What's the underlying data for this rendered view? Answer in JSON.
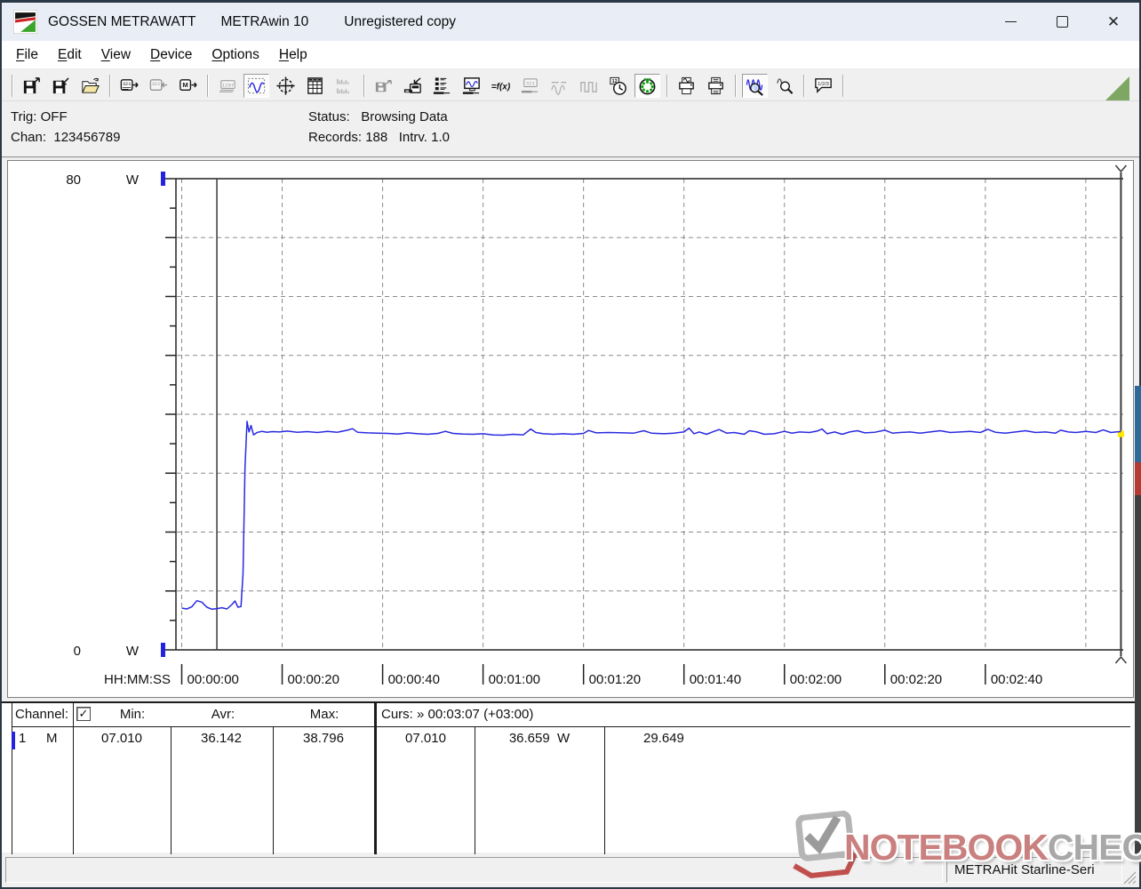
{
  "window": {
    "brand": "GOSSEN METRAWATT",
    "app": "METRAwin 10",
    "license": "Unregistered copy"
  },
  "menu": {
    "items": [
      "File",
      "Edit",
      "View",
      "Device",
      "Options",
      "Help"
    ]
  },
  "toolbar": {
    "buttons": [
      {
        "sep": true
      },
      {
        "icon": "save-chart",
        "name": "save-chart-button",
        "state": "normal"
      },
      {
        "icon": "save-data",
        "name": "save-data-button",
        "state": "normal"
      },
      {
        "icon": "open-file",
        "name": "open-file-button",
        "state": "normal"
      },
      {
        "sep": true
      },
      {
        "icon": "device-read",
        "name": "read-from-device-button",
        "state": "normal"
      },
      {
        "icon": "device-send",
        "name": "send-to-device-button",
        "state": "disabled"
      },
      {
        "icon": "memory-read",
        "name": "read-memory-button",
        "state": "normal"
      },
      {
        "sep": true
      },
      {
        "icon": "view-numeric",
        "name": "view-numeric-display-button",
        "state": "disabled"
      },
      {
        "icon": "view-line-chart",
        "name": "view-line-chart-button",
        "state": "active"
      },
      {
        "icon": "view-xy",
        "name": "view-xy-plot-button",
        "state": "normal"
      },
      {
        "icon": "view-table",
        "name": "view-data-table-button",
        "state": "normal"
      },
      {
        "icon": "view-histogram",
        "name": "view-histogram-button",
        "state": "disabled"
      },
      {
        "sep": true
      },
      {
        "icon": "export-transfer",
        "name": "export-transfer-button",
        "state": "disabled"
      },
      {
        "icon": "device-store",
        "name": "store-to-device-button",
        "state": "normal"
      },
      {
        "icon": "channel-config",
        "name": "channel-config-button",
        "state": "normal"
      },
      {
        "icon": "monitor",
        "name": "device-monitor-button",
        "state": "normal"
      },
      {
        "icon": "formula",
        "name": "formula-button",
        "state": "normal"
      },
      {
        "icon": "display-config",
        "name": "display-config-button",
        "state": "disabled"
      },
      {
        "icon": "wave-markers",
        "name": "wave-markers-button",
        "state": "disabled"
      },
      {
        "icon": "pulse-wave",
        "name": "pulse-config-button",
        "state": "disabled"
      },
      {
        "icon": "time-clock",
        "name": "time-settings-button",
        "state": "normal"
      },
      {
        "icon": "record-timer",
        "name": "record-timer-button",
        "state": "active"
      },
      {
        "sep": true
      },
      {
        "icon": "print-chart",
        "name": "print-chart-button",
        "state": "normal"
      },
      {
        "icon": "print",
        "name": "print-button",
        "state": "normal"
      },
      {
        "sep": true
      },
      {
        "icon": "zoom-wave",
        "name": "zoom-mode-button",
        "state": "active"
      },
      {
        "icon": "zoom-out-wave",
        "name": "zoom-out-button",
        "state": "normal"
      },
      {
        "sep": true
      },
      {
        "icon": "value-tooltip",
        "name": "value-tooltip-button",
        "state": "normal"
      },
      {
        "sep": true
      }
    ]
  },
  "info": {
    "trig": "Trig: OFF",
    "chan": "Chan:  123456789",
    "status": "Status:   Browsing Data",
    "records": "Records: 188   Intrv. 1.0"
  },
  "chart_data": {
    "type": "line",
    "title": "",
    "xlabel": "HH:MM:SS",
    "ylabel": "W",
    "ylim": [
      0,
      80
    ],
    "y_axis": {
      "top_label": "80",
      "bottom_label": "0",
      "unit": "W",
      "major_step": 10,
      "minor_step": 5
    },
    "grid": "dashed",
    "x_ticks": [
      {
        "t": 0,
        "label": "00:00:00"
      },
      {
        "t": 20,
        "label": "00:00:20"
      },
      {
        "t": 40,
        "label": "00:00:40"
      },
      {
        "t": 60,
        "label": "00:01:00"
      },
      {
        "t": 80,
        "label": "00:01:20"
      },
      {
        "t": 100,
        "label": "00:01:40"
      },
      {
        "t": 120,
        "label": "00:02:00"
      },
      {
        "t": 140,
        "label": "00:02:20"
      },
      {
        "t": 160,
        "label": "00:02:40"
      }
    ],
    "x_grid_seconds": [
      0,
      20,
      40,
      60,
      80,
      100,
      120,
      140,
      160,
      180
    ],
    "cursors": {
      "left_seconds": 7,
      "right_seconds": 187,
      "right_time": "00:03:07",
      "delta": "+03:00"
    },
    "stats": {
      "min": 7.01,
      "avr": 36.142,
      "max": 38.796,
      "cursor_left_value": 7.01,
      "cursor_right_value": 36.659,
      "difference": 29.649,
      "unit": "W"
    },
    "series": [
      {
        "name": "channel-1-power",
        "color": "#2a2ae0",
        "points": [
          [
            0,
            7.1
          ],
          [
            1,
            6.95
          ],
          [
            2,
            7.3
          ],
          [
            3,
            8.35
          ],
          [
            4,
            8.1
          ],
          [
            5,
            7.25
          ],
          [
            6,
            6.9
          ],
          [
            7,
            7.01
          ],
          [
            8,
            7.15
          ],
          [
            9,
            6.95
          ],
          [
            10,
            7.7
          ],
          [
            10.6,
            8.3
          ],
          [
            11.2,
            7.25
          ],
          [
            11.8,
            7.35
          ],
          [
            12.2,
            13.0
          ],
          [
            12.6,
            31.0
          ],
          [
            13,
            38.8
          ],
          [
            13.4,
            37.0
          ],
          [
            13.8,
            38.1
          ],
          [
            14.3,
            36.5
          ],
          [
            15,
            36.9
          ],
          [
            16,
            37.1
          ],
          [
            17,
            36.95
          ],
          [
            18,
            37.05
          ],
          [
            19.5,
            37.0
          ],
          [
            21,
            37.15
          ],
          [
            23,
            36.95
          ],
          [
            25,
            37.05
          ],
          [
            27,
            36.9
          ],
          [
            29,
            37.1
          ],
          [
            31,
            36.95
          ],
          [
            33,
            37.3
          ],
          [
            34,
            37.55
          ],
          [
            35,
            36.95
          ],
          [
            37,
            36.85
          ],
          [
            39,
            36.8
          ],
          [
            41,
            36.75
          ],
          [
            43,
            36.65
          ],
          [
            45,
            36.85
          ],
          [
            47,
            36.7
          ],
          [
            49,
            36.6
          ],
          [
            51,
            36.75
          ],
          [
            52.5,
            37.1
          ],
          [
            54,
            36.75
          ],
          [
            56,
            36.65
          ],
          [
            58,
            36.6
          ],
          [
            60,
            36.7
          ],
          [
            62,
            36.5
          ],
          [
            64,
            36.45
          ],
          [
            66,
            36.6
          ],
          [
            68,
            36.5
          ],
          [
            69.5,
            37.5
          ],
          [
            70.5,
            36.9
          ],
          [
            72,
            36.7
          ],
          [
            74,
            36.6
          ],
          [
            76,
            36.7
          ],
          [
            78,
            36.6
          ],
          [
            80,
            36.75
          ],
          [
            81,
            37.25
          ],
          [
            82.5,
            36.85
          ],
          [
            85,
            36.9
          ],
          [
            88,
            36.85
          ],
          [
            90,
            36.8
          ],
          [
            92,
            37.2
          ],
          [
            93.5,
            36.8
          ],
          [
            96,
            36.7
          ],
          [
            98,
            36.8
          ],
          [
            100,
            37.0
          ],
          [
            101,
            37.65
          ],
          [
            102,
            36.7
          ],
          [
            103,
            37.0
          ],
          [
            104.5,
            36.6
          ],
          [
            106,
            37.1
          ],
          [
            107,
            37.4
          ],
          [
            108.5,
            36.8
          ],
          [
            110,
            36.9
          ],
          [
            112,
            36.6
          ],
          [
            113,
            37.2
          ],
          [
            114.5,
            37.0
          ],
          [
            116,
            36.6
          ],
          [
            118,
            36.7
          ],
          [
            120,
            37.1
          ],
          [
            121.5,
            36.8
          ],
          [
            123,
            37.0
          ],
          [
            125,
            36.9
          ],
          [
            126.5,
            37.15
          ],
          [
            127.5,
            37.5
          ],
          [
            128.5,
            36.7
          ],
          [
            130,
            37.0
          ],
          [
            131.5,
            36.6
          ],
          [
            133,
            37.0
          ],
          [
            134.5,
            37.2
          ],
          [
            136,
            36.85
          ],
          [
            138,
            36.95
          ],
          [
            140,
            37.3
          ],
          [
            141.5,
            36.8
          ],
          [
            143,
            36.9
          ],
          [
            145,
            37.0
          ],
          [
            147,
            36.8
          ],
          [
            149,
            37.0
          ],
          [
            151,
            37.2
          ],
          [
            153,
            36.9
          ],
          [
            155,
            37.0
          ],
          [
            157,
            37.1
          ],
          [
            159,
            36.9
          ],
          [
            160.5,
            37.45
          ],
          [
            162,
            36.95
          ],
          [
            164,
            36.8
          ],
          [
            166,
            37.0
          ],
          [
            168,
            37.2
          ],
          [
            170,
            36.9
          ],
          [
            172,
            37.0
          ],
          [
            174,
            36.8
          ],
          [
            175,
            37.3
          ],
          [
            176.5,
            37.0
          ],
          [
            178,
            36.9
          ],
          [
            180,
            37.1
          ],
          [
            182,
            36.9
          ],
          [
            183.5,
            37.35
          ],
          [
            185,
            36.9
          ],
          [
            186,
            37.0
          ],
          [
            187,
            37.05
          ]
        ]
      }
    ]
  },
  "table": {
    "channel_header": "Channel:",
    "checkbox_checked": true,
    "min_header": "Min:",
    "avr_header": "Avr:",
    "max_header": "Max:",
    "curs_header": "Curs: » 00:03:07 (+03:00)",
    "row": {
      "num": "1",
      "mode": "M",
      "min": "07.010",
      "avr": "36.142",
      "max": "38.796",
      "curs_left": "07.010",
      "curs_right": "36.659  W",
      "diff": "29.649"
    }
  },
  "statusbar": {
    "device": "METRAHit Starline-Seri"
  },
  "watermark": {
    "part1": "NOTEBOOK",
    "part2": "CHECK"
  },
  "colors": {
    "accent_blue": "#2a2ae0",
    "grid_gray": "#8a8a8a",
    "cursor_dark": "#3a3a3a",
    "axis_marker_blue": "#2222e0",
    "record_green": "#18a018",
    "triangle_green": "#7ea763",
    "watermark_red": "#c9807f",
    "watermark_gray": "#a8a8a8",
    "edge_blue": "#2e6a99",
    "edge_red": "#b23c33",
    "edge_dark": "#3f3f3f",
    "marker_yellow": "#ffe800"
  }
}
